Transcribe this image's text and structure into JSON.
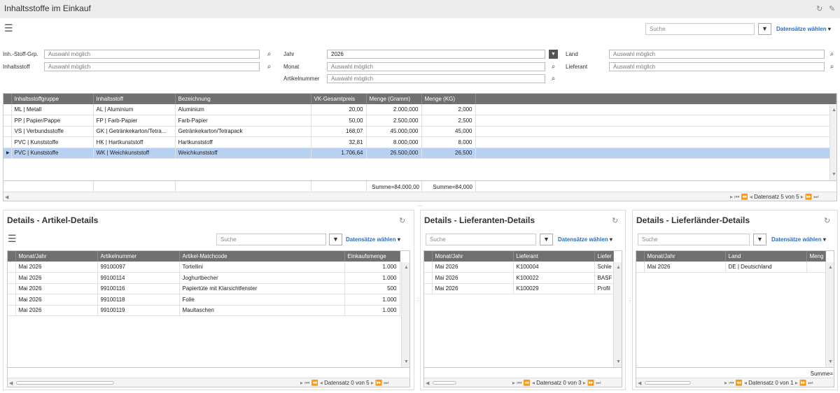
{
  "app": {
    "title": "Inhaltsstoffe im Einkauf"
  },
  "toolbar": {
    "search_placeholder": "Suche",
    "records_label": "Datensätze wählen"
  },
  "filters": {
    "group": {
      "label": "Inh.-Stoff-Grp.",
      "value": "Auswahl möglich"
    },
    "substance": {
      "label": "Inhaltsstoff",
      "value": "Auswahl möglich"
    },
    "year": {
      "label": "Jahr",
      "value": "2026"
    },
    "month": {
      "label": "Monat",
      "value": "Auswahl möglich"
    },
    "article": {
      "label": "Artikelnummer",
      "value": "Auswahl möglich"
    },
    "country": {
      "label": "Land",
      "value": "Auswahl möglich"
    },
    "supplier": {
      "label": "Lieferant",
      "value": "Auswahl möglich"
    }
  },
  "main_grid": {
    "columns": [
      "Inhaltsstoffgruppe",
      "Inhaltsstoff",
      "Bezeichnung",
      "VK-Gesamtpreis",
      "Menge (Gramm)",
      "Menge (KG)"
    ],
    "rows": [
      [
        "ML | Metall",
        "AL | Aluminium",
        "Aluminium",
        "20,00",
        "2.000,000",
        "2,000"
      ],
      [
        "PP | Papier/Pappe",
        "FP | Farb-Papier",
        "Farb-Papier",
        "50,00",
        "2.500,000",
        "2,500"
      ],
      [
        "VS | Verbundsstoffe",
        "GK | Getränkekarton/Tetra...",
        "Getränkekarton/Tetrapack",
        "168,07",
        "45.000,000",
        "45,000"
      ],
      [
        "PVC | Kunststoffe",
        "HK | Hartkunststoff",
        "Hartkunststoff",
        "32,81",
        "8.000,000",
        "8,000"
      ],
      [
        "PVC | Kunststoffe",
        "WK | Weichkunststoff",
        "Weichkunststoff",
        "1.706,64",
        "26.500,000",
        "26,500"
      ]
    ],
    "selected_row": 4,
    "sum_gram": "Summe=84.000,00",
    "sum_kg": "Summe=84,000",
    "pager": "Datensatz 5 von 5"
  },
  "articles": {
    "title": "Details - Artikel-Details",
    "search_placeholder": "Suche",
    "records_label": "Datensätze wählen",
    "columns": [
      "Monat/Jahr",
      "Artikelnummer",
      "Artikel-Matchcode",
      "Einkaufsmenge"
    ],
    "rows": [
      [
        "Mai 2026",
        "99100097",
        "Tortellini",
        "1.000"
      ],
      [
        "Mai 2026",
        "99100114",
        "Joghurtbecher",
        "1.000"
      ],
      [
        "Mai 2026",
        "99100116",
        "Papiertüte mit Klarsichtfenster",
        "500"
      ],
      [
        "Mai 2026",
        "99100118",
        "Folie",
        "1.000"
      ],
      [
        "Mai 2026",
        "99100119",
        "Maultaschen",
        "1.000"
      ]
    ],
    "pager": "Datensatz 0 von 5"
  },
  "suppliers": {
    "title": "Details - Lieferanten-Details",
    "search_placeholder": "Suche",
    "records_label": "Datensätze wählen",
    "columns": [
      "Monat/Jahr",
      "Lieferant",
      "Liefer"
    ],
    "rows": [
      [
        "Mai 2026",
        "K100004",
        "Schle"
      ],
      [
        "Mai 2026",
        "K100022",
        "BASF"
      ],
      [
        "Mai 2026",
        "K100029",
        "Profil"
      ]
    ],
    "pager": "Datensatz 0 von 3"
  },
  "countries": {
    "title": "Details - Lieferländer-Details",
    "search_placeholder": "Suche",
    "records_label": "Datensätze wählen",
    "columns": [
      "Monat/Jahr",
      "Land",
      "Meng"
    ],
    "rows": [
      [
        "Mai 2026",
        "DE | Deutschland",
        ""
      ]
    ],
    "sum": "Summe=",
    "pager": "Datensatz 0 von 1"
  },
  "colors": {
    "header_bg": "#707070",
    "selected_row": "#b7d1f3",
    "link": "#2a6ec0",
    "titlebar": "#ececec"
  }
}
